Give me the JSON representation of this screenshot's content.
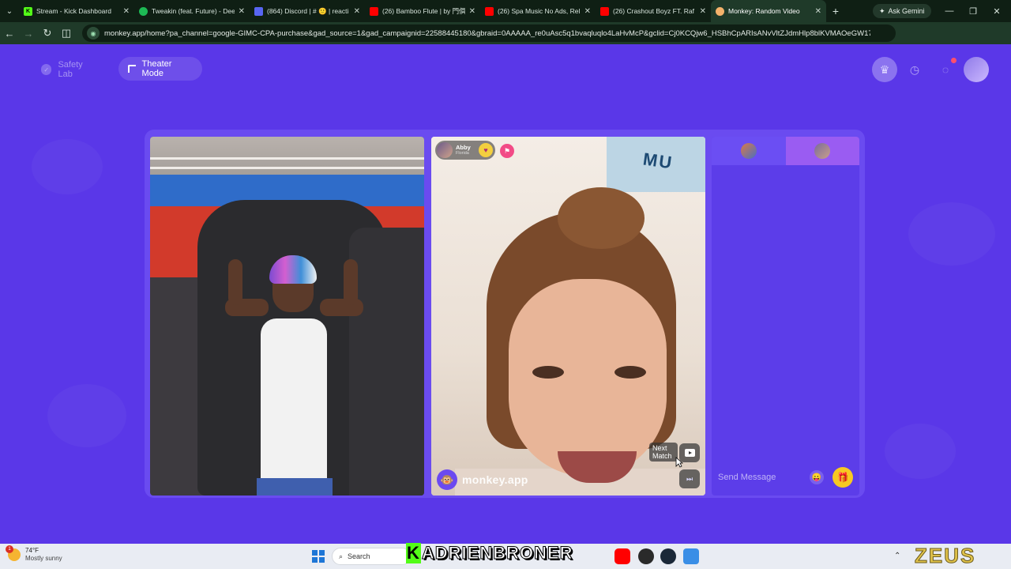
{
  "browser": {
    "tabs": [
      {
        "title": "Stream - Kick Dashboard",
        "favicon": "kick-icon",
        "color": "#53fc18"
      },
      {
        "title": "Tweakin (feat. Future) - Dee",
        "favicon": "spotify-icon",
        "color": "#1db954"
      },
      {
        "title": "(864) Discord | # 🙂 | reacti",
        "favicon": "discord-icon",
        "color": "#5865f2"
      },
      {
        "title": "(26) Bamboo Flute | by 門俱",
        "favicon": "youtube-icon",
        "color": "#ff0000"
      },
      {
        "title": "(26) Spa Music No Ads, Rel",
        "favicon": "youtube-icon",
        "color": "#ff0000"
      },
      {
        "title": "(26) Crashout Boyz FT. Raf",
        "favicon": "youtube-icon",
        "color": "#ff0000"
      },
      {
        "title": "Monkey: Random Video",
        "favicon": "monkey-icon",
        "color": "#f4b26b",
        "active": true
      }
    ],
    "ask_gemini": "Ask Gemini",
    "url": "monkey.app/home?pa_channel=google-GIMC-CPA-purchase&gad_source=1&gad_campaignid=22588445180&gbraid=0AAAAA_re0uAsc5q1bvaqluqlo4LaHvMcP&gclid=Cj0KCQjw6_HSBhCpARIsANvVltZJdmHlp8blKVMAOeGW17G..."
  },
  "header": {
    "safety_lab": "Safety Lab",
    "theater_mode": "Theater Mode",
    "notification_count": "1"
  },
  "match": {
    "name": "Abby",
    "location": "Florida",
    "watermark": "monkey.app",
    "next_match": "Next Match"
  },
  "chat": {
    "placeholder": "Send Message"
  },
  "taskbar": {
    "temperature": "74°F",
    "weather": "Mostly sunny",
    "weather_badge": "1",
    "search": "Search",
    "overlay_text": "ADRIENBRONER",
    "overlay_prefix": "K",
    "brand": "ZEUS"
  },
  "colors": {
    "page_bg": "#5a37e8",
    "stage_bg": "#6a4bf0",
    "gift": "#f7c923",
    "flag": "#f24b86"
  }
}
